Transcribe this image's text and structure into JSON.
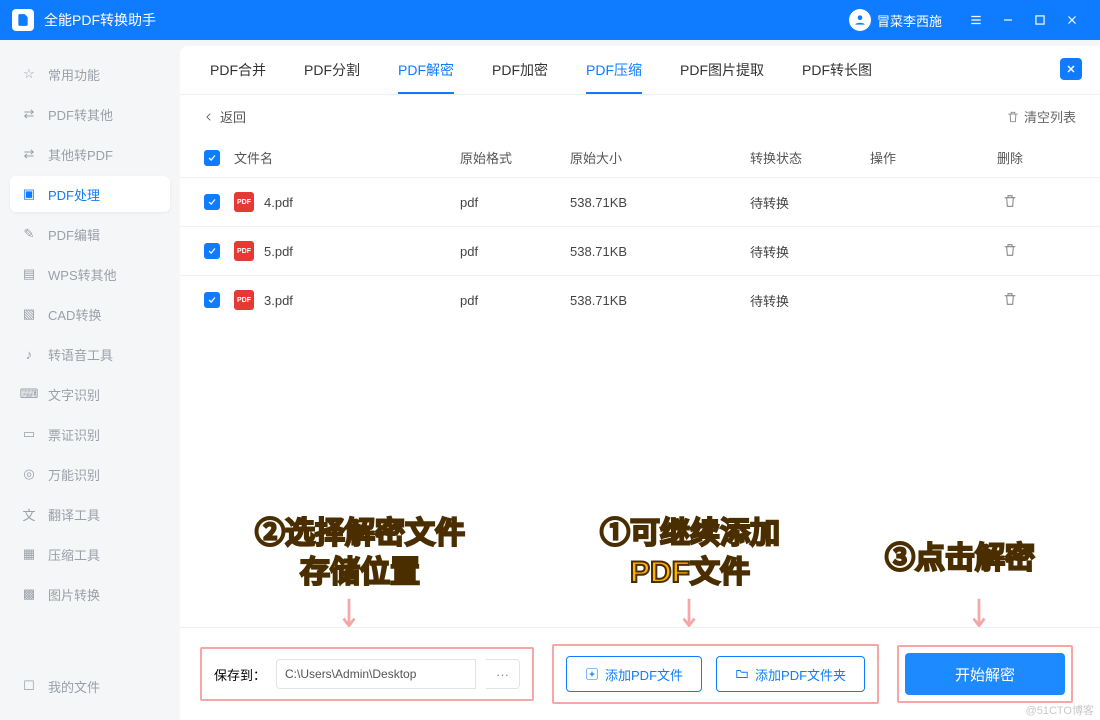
{
  "titlebar": {
    "app_name": "全能PDF转换助手",
    "username": "冒菜李西施"
  },
  "sidebar": {
    "items": [
      {
        "label": "常用功能"
      },
      {
        "label": "PDF转其他"
      },
      {
        "label": "其他转PDF"
      },
      {
        "label": "PDF处理"
      },
      {
        "label": "PDF编辑"
      },
      {
        "label": "WPS转其他"
      },
      {
        "label": "CAD转换"
      },
      {
        "label": "转语音工具"
      },
      {
        "label": "文字识别"
      },
      {
        "label": "票证识别"
      },
      {
        "label": "万能识别"
      },
      {
        "label": "翻译工具"
      },
      {
        "label": "压缩工具"
      },
      {
        "label": "图片转换"
      }
    ],
    "active_index": 3,
    "my_files_label": "我的文件"
  },
  "tabs": {
    "items": [
      {
        "label": "PDF合并"
      },
      {
        "label": "PDF分割"
      },
      {
        "label": "PDF解密"
      },
      {
        "label": "PDF加密"
      },
      {
        "label": "PDF压缩"
      },
      {
        "label": "PDF图片提取"
      },
      {
        "label": "PDF转长图"
      }
    ],
    "active": [
      2,
      4
    ]
  },
  "subbar": {
    "back": "返回",
    "clear": "清空列表"
  },
  "table": {
    "headers": {
      "name": "文件名",
      "format": "原始格式",
      "size": "原始大小",
      "status": "转换状态",
      "op": "操作",
      "del": "删除"
    },
    "rows": [
      {
        "name": "4.pdf",
        "format": "pdf",
        "size": "538.71KB",
        "status": "待转换"
      },
      {
        "name": "5.pdf",
        "format": "pdf",
        "size": "538.71KB",
        "status": "待转换"
      },
      {
        "name": "3.pdf",
        "format": "pdf",
        "size": "538.71KB",
        "status": "待转换"
      }
    ]
  },
  "annotations": {
    "a1": "①可继续添加\nPDF文件",
    "a2": "②选择解密文件\n存储位置",
    "a3": "③点击解密"
  },
  "footer": {
    "save_to": "保存到：",
    "path": "C:\\Users\\Admin\\Desktop",
    "add_file": "添加PDF文件",
    "add_folder": "添加PDF文件夹",
    "start": "开始解密"
  },
  "watermark": "@51CTO博客"
}
